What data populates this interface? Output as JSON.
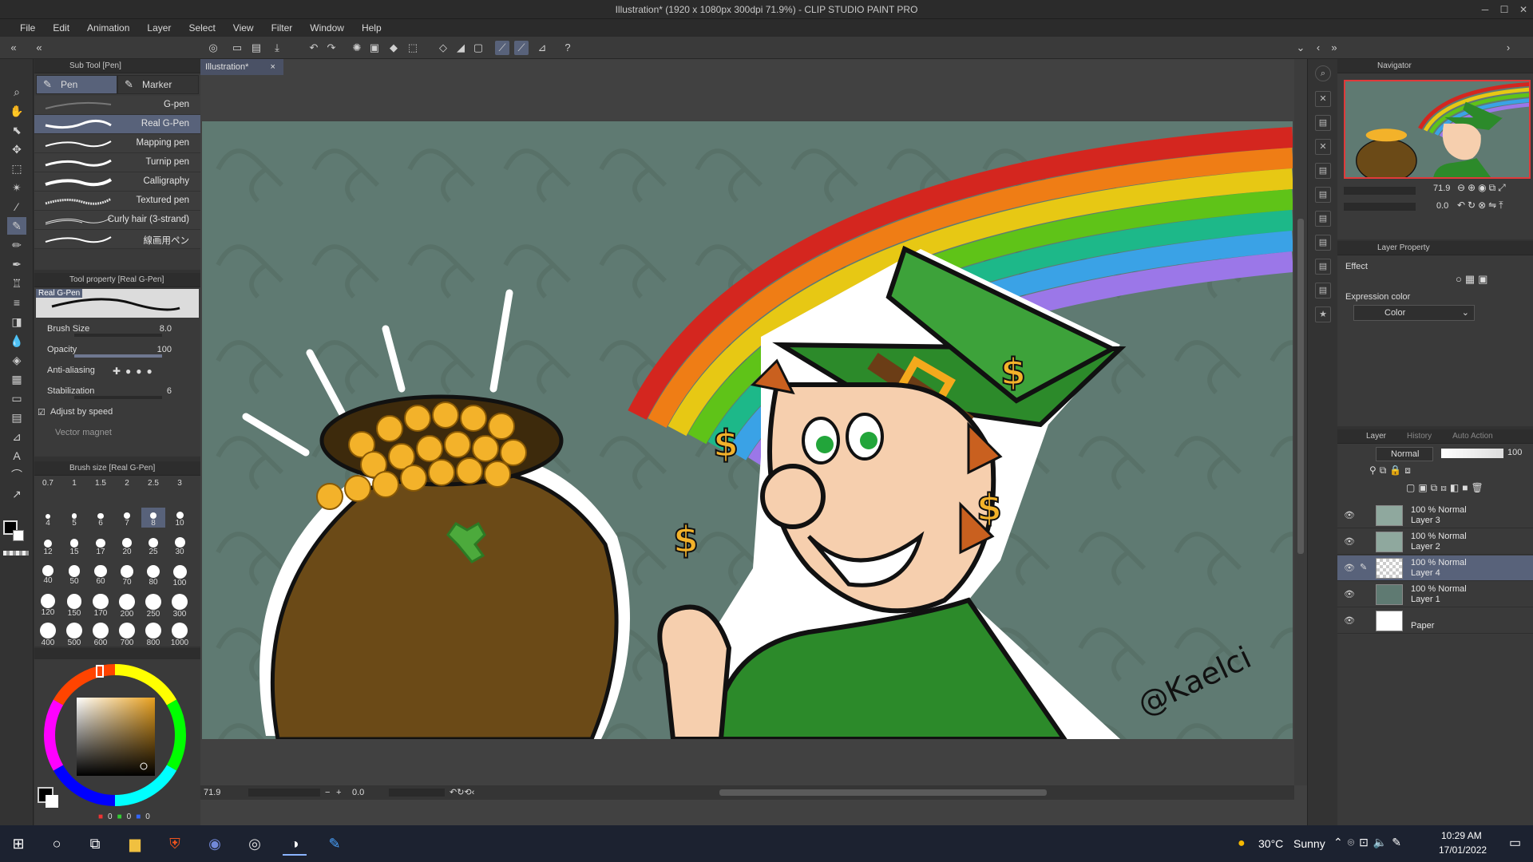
{
  "window": {
    "title": "Illustration* (1920 x 1080px 300dpi 71.9%)  - CLIP STUDIO PAINT PRO",
    "controls": [
      "─",
      "☐",
      "✕"
    ]
  },
  "menu": [
    "File",
    "Edit",
    "Animation",
    "Layer",
    "Select",
    "View",
    "Filter",
    "Window",
    "Help"
  ],
  "subtool": {
    "header": "Sub Tool [Pen]",
    "tabs": [
      "Pen",
      "Marker"
    ],
    "pens": [
      "G-pen",
      "Real G-Pen",
      "Mapping pen",
      "Turnip pen",
      "Calligraphy",
      "Textured pen",
      "Curly hair (3-strand)",
      "線画用ペン"
    ],
    "selected": "Real G-Pen"
  },
  "toolprop": {
    "header": "Tool property [Real G-Pen]",
    "preview_label": "Real G-Pen",
    "brush_size_label": "Brush Size",
    "brush_size": "8.0",
    "opacity_label": "Opacity",
    "opacity": "100",
    "antialiasing_label": "Anti-aliasing",
    "stabilization_label": "Stabilization",
    "stabilization": "6",
    "adjust_label": "Adjust by speed",
    "vector_magnet_label": "Vector magnet"
  },
  "brushsize": {
    "header": "Brush size [Real G-Pen]",
    "sizes": [
      "0.7",
      "1",
      "1.5",
      "2",
      "2.5",
      "3",
      "4",
      "5",
      "6",
      "7",
      "8",
      "10",
      "12",
      "15",
      "17",
      "20",
      "25",
      "30",
      "40",
      "50",
      "60",
      "70",
      "80",
      "100",
      "120",
      "150",
      "170",
      "200",
      "250",
      "300",
      "400",
      "500",
      "600",
      "700",
      "800",
      "1000"
    ],
    "selected": "8"
  },
  "color": {
    "r": "0",
    "g": "0",
    "b": "0",
    "main": "#000000",
    "sub": "#ffffff",
    "picked": "#d9a12c"
  },
  "canvas": {
    "doc_tab": "Illustration*",
    "zoom": "71.9",
    "angle": "0.0",
    "signature": "@Kaelci",
    "bg": "#5f7a72"
  },
  "navigator": {
    "header": "Navigator",
    "zoom": "71.9",
    "angle": "0.0"
  },
  "layerprop": {
    "header": "Layer Property",
    "effect_label": "Effect",
    "expression_label": "Expression color",
    "expression_value": "Color"
  },
  "layer": {
    "tabs": [
      "Layer",
      "History",
      "Auto Action"
    ],
    "blend": "Normal",
    "opacity": "100",
    "rows": [
      {
        "mode": "100 % Normal",
        "name": "Layer 3"
      },
      {
        "mode": "100 % Normal",
        "name": "Layer 2"
      },
      {
        "mode": "100 % Normal",
        "name": "Layer 4"
      },
      {
        "mode": "100 % Normal",
        "name": "Layer 1"
      },
      {
        "mode": "",
        "name": "Paper"
      }
    ]
  },
  "taskbar": {
    "weather_temp": "30°C",
    "weather_text": "Sunny",
    "time": "10:29 AM",
    "date": "17/01/2022"
  }
}
